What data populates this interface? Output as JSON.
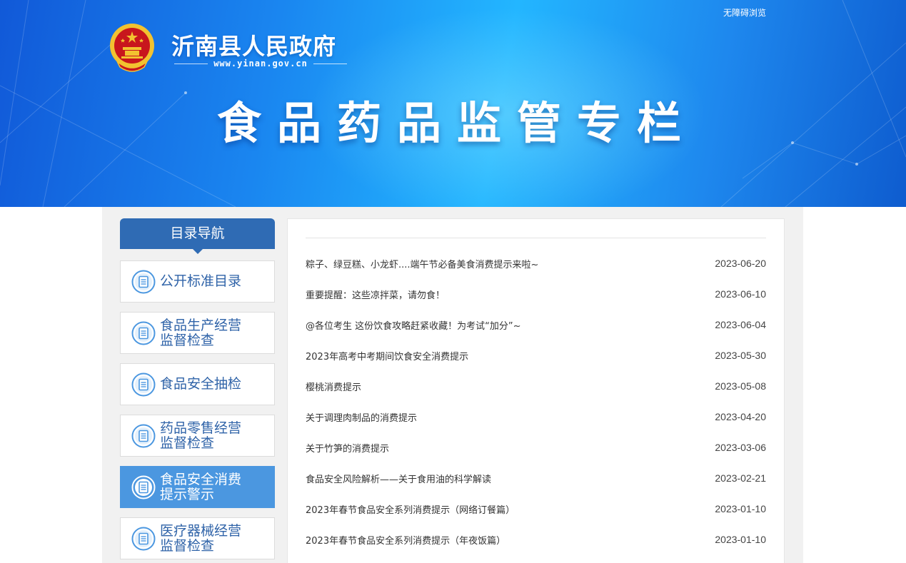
{
  "header": {
    "accessibility_label": "无障碍浏览",
    "site_name": "沂南县人民政府",
    "site_url": "www.yinan.gov.cn",
    "column_title": "食品药品监管专栏"
  },
  "sidebar": {
    "title": "目录导航",
    "items": [
      {
        "label": "公开标准目录",
        "active": false
      },
      {
        "label": "食品生产经营监督检查",
        "active": false
      },
      {
        "label": "食品安全抽检",
        "active": false
      },
      {
        "label": "药品零售经营监督检查",
        "active": false
      },
      {
        "label": "食品安全消费提示警示",
        "active": true
      },
      {
        "label": "医疗器械经营监督检查",
        "active": false
      }
    ]
  },
  "articles": [
    {
      "title": "粽子、绿豆糕、小龙虾....端午节必备美食消费提示来啦~",
      "date": "2023-06-20"
    },
    {
      "title": "重要提醒：这些凉拌菜，请勿食！",
      "date": "2023-06-10"
    },
    {
      "title": "@各位考生 这份饮食攻略赶紧收藏！为考试“加分”~",
      "date": "2023-06-04"
    },
    {
      "title": "2023年高考中考期间饮食安全消费提示",
      "date": "2023-05-30"
    },
    {
      "title": "樱桃消费提示",
      "date": "2023-05-08"
    },
    {
      "title": "关于调理肉制品的消费提示",
      "date": "2023-04-20"
    },
    {
      "title": "关于竹笋的消费提示",
      "date": "2023-03-06"
    },
    {
      "title": "食品安全风险解析——关于食用油的科学解读",
      "date": "2023-02-21"
    },
    {
      "title": "2023年春节食品安全系列消费提示（网络订餐篇）",
      "date": "2023-01-10"
    },
    {
      "title": "2023年春节食品安全系列消费提示（年夜饭篇）",
      "date": "2023-01-10"
    }
  ],
  "colors": {
    "banner_blue": "#1a86f0",
    "nav_head": "#2f6bb4",
    "nav_active": "#4b97e0",
    "nav_text": "#2f63a8",
    "emblem_red": "#c8161d",
    "emblem_gold": "#f2c230"
  },
  "icons": {
    "emblem": "national-emblem-icon",
    "nav_item": "document-circle-icon"
  }
}
